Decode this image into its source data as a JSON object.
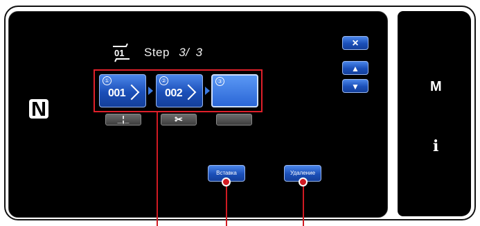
{
  "step": {
    "icon_label": "01",
    "label": "Step",
    "current": "3/",
    "total": "3"
  },
  "nav": {
    "close_icon": "×",
    "up_icon": "▲",
    "down_icon": "▼"
  },
  "patterns": [
    {
      "index": "①",
      "code": "001",
      "selected": false
    },
    {
      "index": "②",
      "code": "002",
      "selected": false
    },
    {
      "index": "③",
      "code": "",
      "selected": true
    }
  ],
  "tools": [
    {
      "icon": "needle-position-icon",
      "glyph": "_¦_"
    },
    {
      "icon": "scissors-icon",
      "glyph": "✂"
    },
    {
      "icon": "blank",
      "glyph": ""
    }
  ],
  "actions": {
    "insert": "Вставка",
    "delete": "Удаление"
  },
  "side": {
    "menu_label": "M",
    "info_label": "i"
  },
  "colors": {
    "accent_blue": "#1b4fb8",
    "callout_red": "#d01a22"
  }
}
